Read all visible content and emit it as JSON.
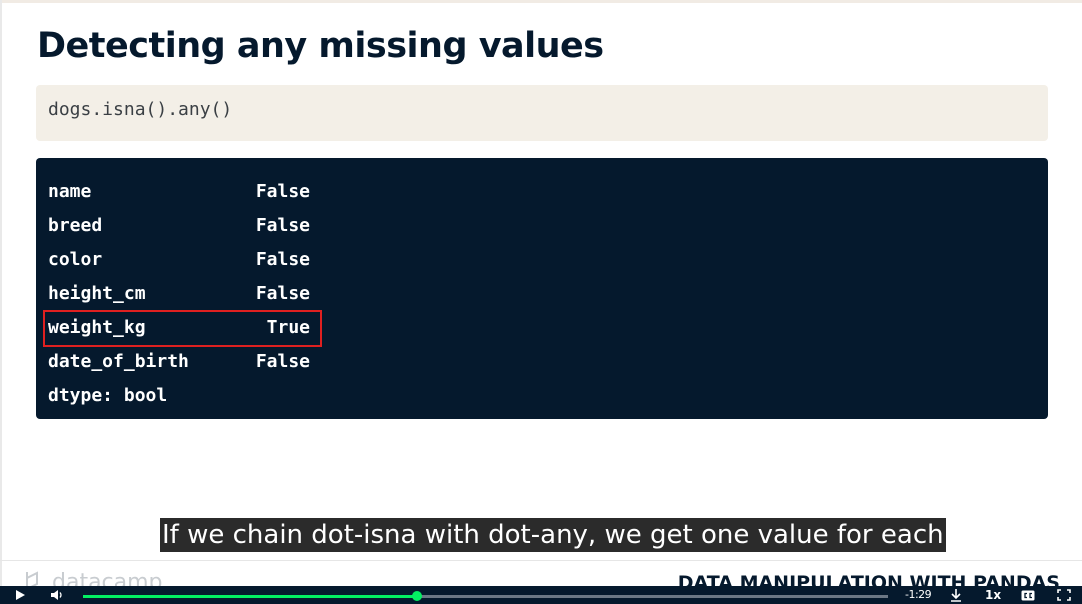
{
  "slide": {
    "title": "Detecting any missing values",
    "code_input": "dogs.isna().any()",
    "output_rows": [
      {
        "key": "name",
        "value": "False"
      },
      {
        "key": "breed",
        "value": "False"
      },
      {
        "key": "color",
        "value": "False"
      },
      {
        "key": "height_cm",
        "value": "False"
      },
      {
        "key": "weight_kg",
        "value": "True"
      },
      {
        "key": "date_of_birth",
        "value": "False"
      }
    ],
    "dtype_line": "dtype: bool",
    "highlighted_row": "weight_kg"
  },
  "caption": "If we chain dot-isna with dot-any, we get one value for each",
  "footer": {
    "brand": "datacamp",
    "course": "DATA MANIPULATION WITH PANDAS"
  },
  "player": {
    "time_remaining": "-1:29",
    "speed": "1x",
    "progress_fraction": 0.415,
    "accent_color": "#03ef62",
    "icons": [
      "play-icon",
      "volume-icon",
      "download-icon",
      "captions-icon",
      "fullscreen-icon"
    ]
  },
  "colors": {
    "title": "#05192d",
    "code_input_bg": "#f3efe7",
    "code_output_bg": "#05192d",
    "highlight_border": "#e02020"
  }
}
